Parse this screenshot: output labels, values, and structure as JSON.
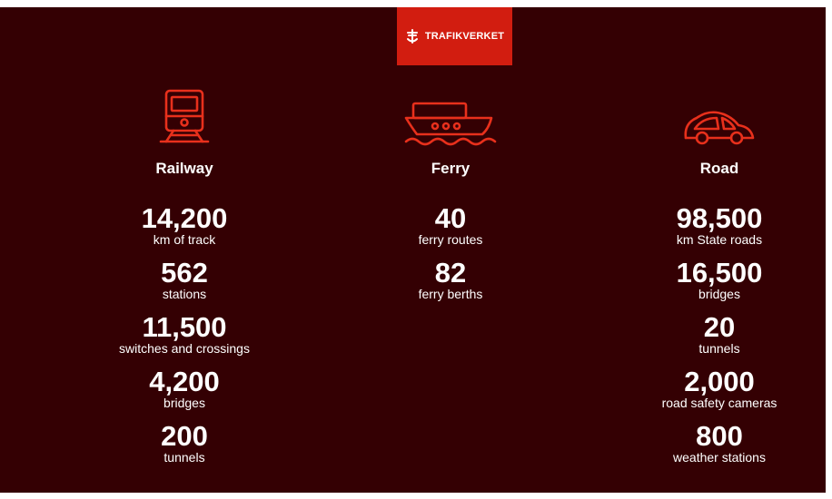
{
  "logo": {
    "text": "TRAFIKVERKET"
  },
  "colors": {
    "background": "#340003",
    "accent": "#d21d10",
    "icon_stroke": "#e8301c",
    "text": "#ffffff"
  },
  "columns": [
    {
      "icon": "train-icon",
      "heading": "Railway",
      "stats": [
        {
          "value": "14,200",
          "label": "km of track"
        },
        {
          "value": "562",
          "label": "stations"
        },
        {
          "value": "11,500",
          "label": "switches and crossings"
        },
        {
          "value": "4,200",
          "label": "bridges"
        },
        {
          "value": "200",
          "label": "tunnels"
        }
      ]
    },
    {
      "icon": "ferry-icon",
      "heading": "Ferry",
      "stats": [
        {
          "value": "40",
          "label": "ferry routes"
        },
        {
          "value": "82",
          "label": "ferry berths"
        }
      ]
    },
    {
      "icon": "car-icon",
      "heading": "Road",
      "stats": [
        {
          "value": "98,500",
          "label": "km State roads"
        },
        {
          "value": "16,500",
          "label": "bridges"
        },
        {
          "value": "20",
          "label": "tunnels"
        },
        {
          "value": "2,000",
          "label": "road safety cameras"
        },
        {
          "value": "800",
          "label": "weather stations"
        }
      ]
    }
  ]
}
